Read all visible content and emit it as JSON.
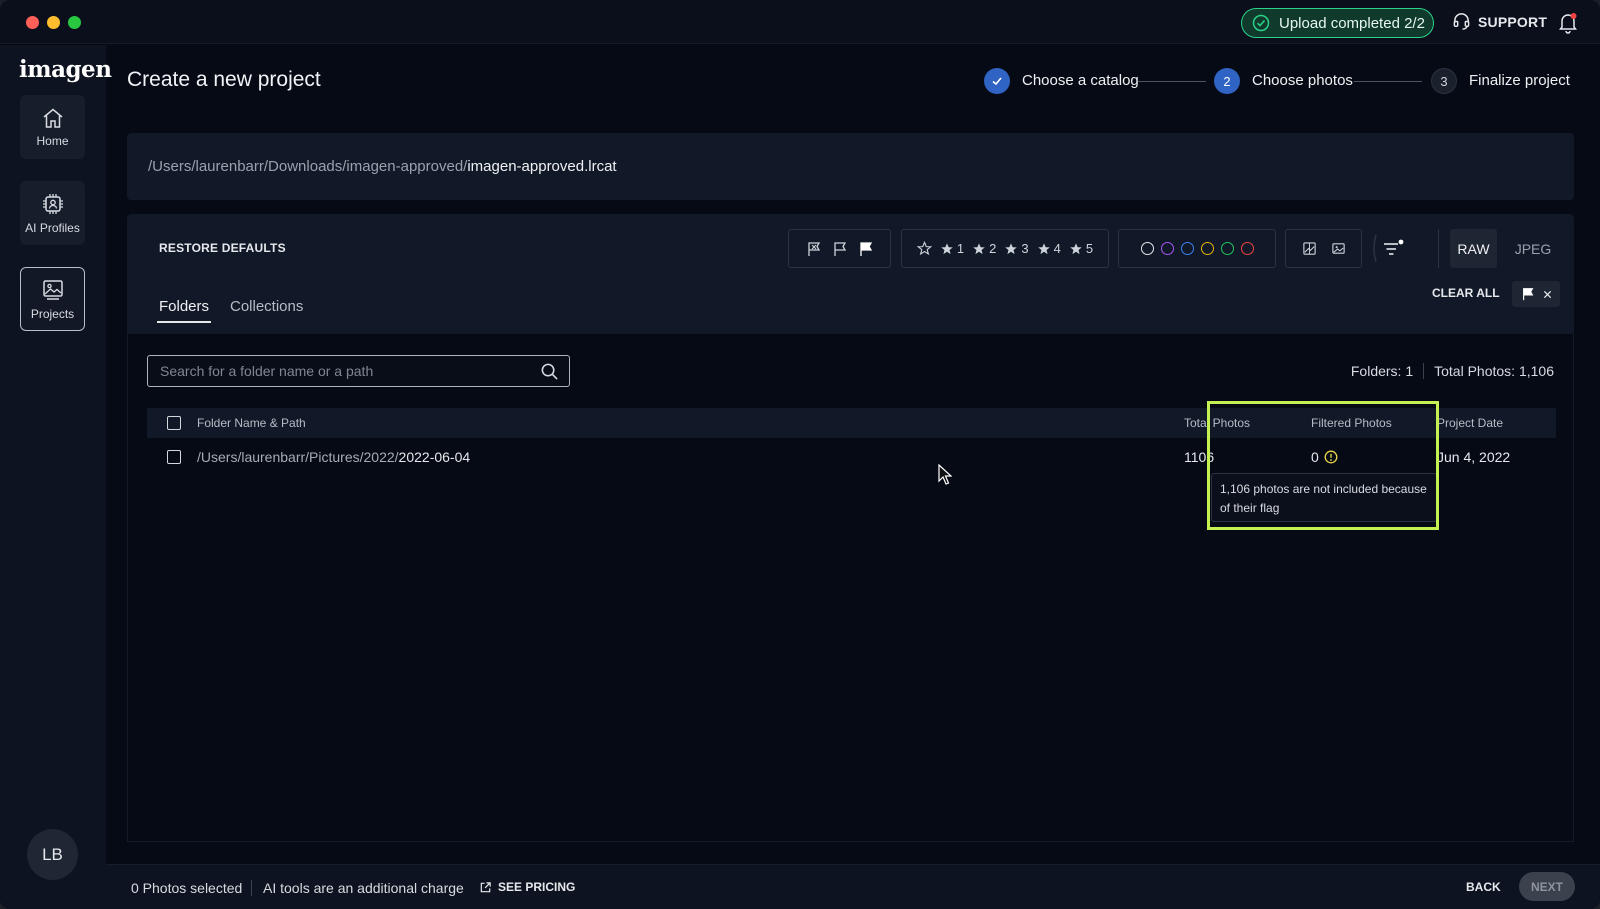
{
  "titlebar": {
    "upload_status": "Upload completed 2/2",
    "support_label": "SUPPORT"
  },
  "sidebar": {
    "logo": "imagen",
    "items": [
      {
        "label": "Home",
        "icon": "home-icon"
      },
      {
        "label": "AI Profiles",
        "icon": "ai-chip-icon"
      },
      {
        "label": "Projects",
        "icon": "projects-icon"
      }
    ],
    "avatar_initials": "LB"
  },
  "header": {
    "title": "Create a new project",
    "steps": [
      {
        "label": "Choose a catalog",
        "state": "done"
      },
      {
        "number": "2",
        "label": "Choose photos",
        "state": "current"
      },
      {
        "number": "3",
        "label": "Finalize project",
        "state": "pending"
      }
    ]
  },
  "catalog": {
    "path_prefix": "/Users/laurenbarr/Downloads/imagen-approved/",
    "path_file": "imagen-approved.lrcat"
  },
  "filters": {
    "restore_label": "RESTORE DEFAULTS",
    "stars": [
      "1",
      "2",
      "3",
      "4",
      "5"
    ],
    "color_labels": [
      "#e6e8ec",
      "#a855f7",
      "#3b82f6",
      "#eab308",
      "#22c55e",
      "#ef4444"
    ],
    "raw_label": "RAW",
    "jpeg_label": "JPEG",
    "clear_all_label": "CLEAR ALL"
  },
  "tabs": {
    "folders": "Folders",
    "collections": "Collections"
  },
  "search": {
    "placeholder": "Search for a folder name or a path"
  },
  "summary": {
    "folders": "Folders: 1",
    "total": "Total Photos: 1,106"
  },
  "table": {
    "columns": {
      "name": "Folder Name & Path",
      "total": "Total Photos",
      "filtered": "Filtered Photos",
      "date": "Project Date"
    },
    "rows": [
      {
        "path_prefix": "/Users/laurenbarr/Pictures/2022/",
        "folder": "2022-06-04",
        "total": "1106",
        "filtered": "0",
        "date": "Jun 4, 2022"
      }
    ]
  },
  "tooltip": {
    "text": "1,106 photos are not included because of their flag"
  },
  "footer": {
    "selected": "0 Photos selected",
    "ai_note": "AI tools are an additional charge",
    "pricing": "SEE PRICING",
    "back": "BACK",
    "next": "NEXT"
  },
  "colors": {
    "accent": "#2f63c4",
    "success": "#2bd28a",
    "highlight": "#c4f052",
    "warning": "#e8d34a"
  }
}
